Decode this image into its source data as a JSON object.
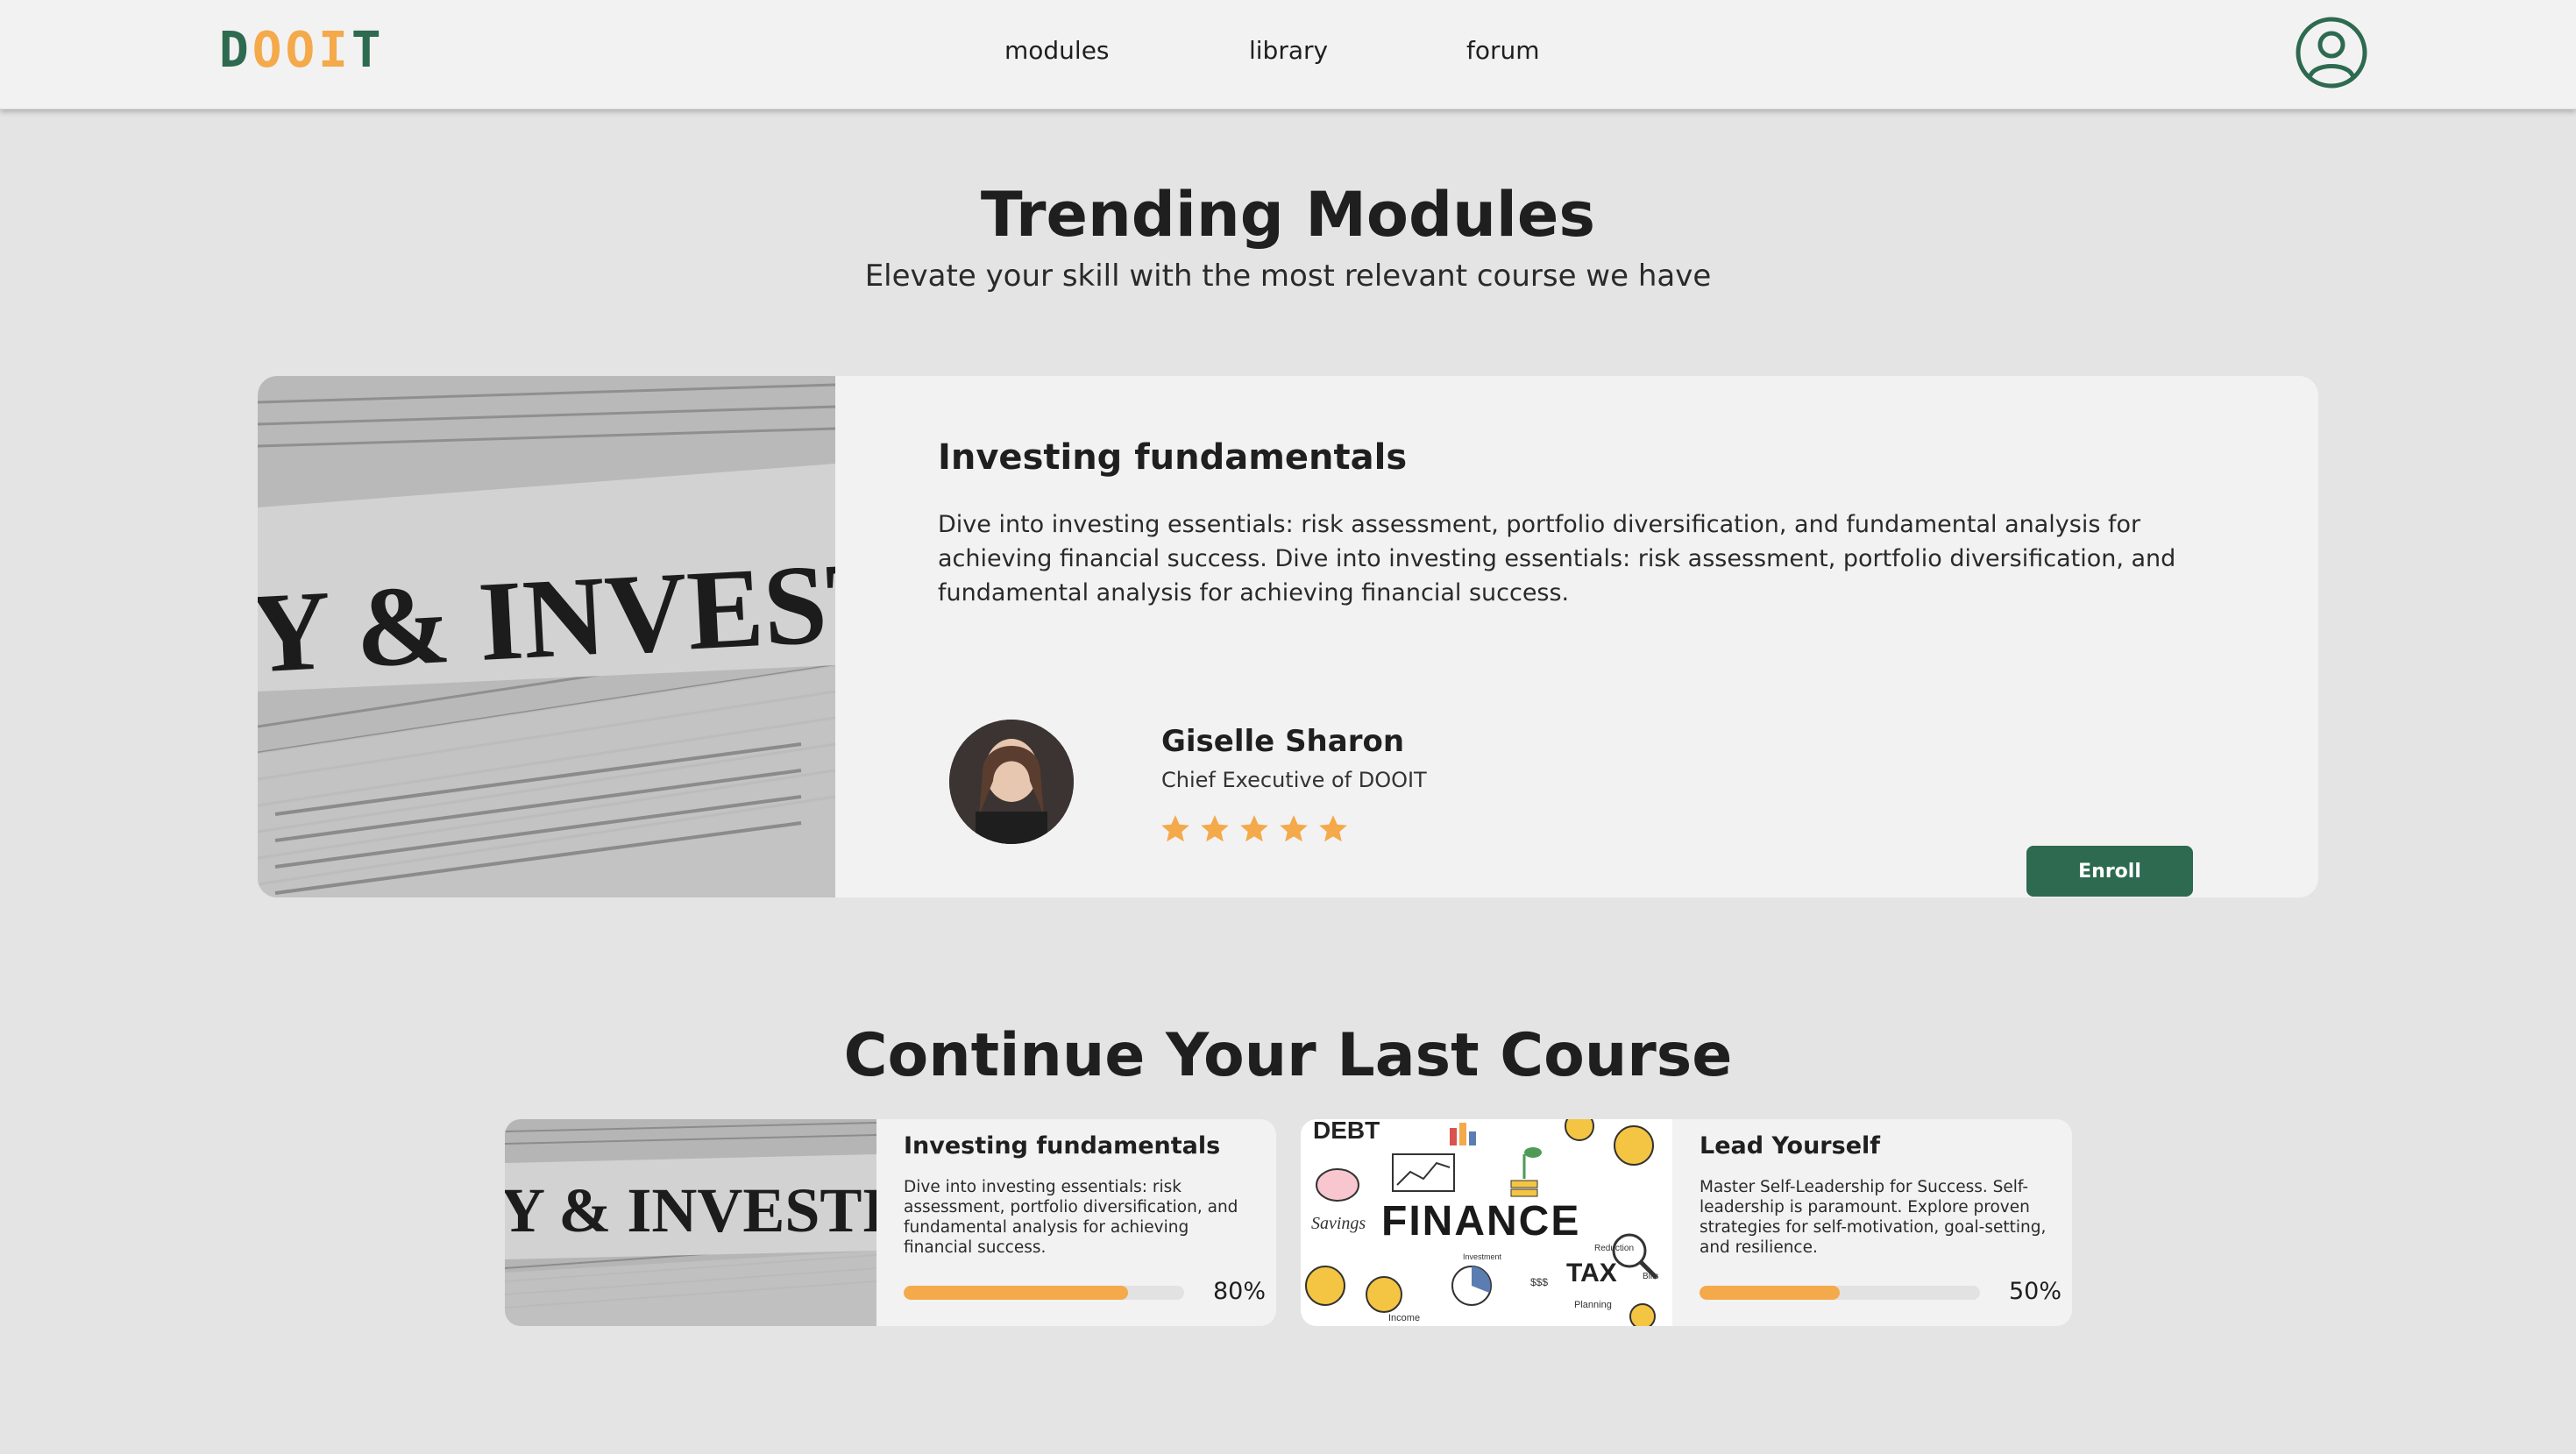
{
  "brand": {
    "logo_letters": [
      "D",
      "O",
      "O",
      "I",
      "T"
    ],
    "logo_colors": [
      "#2d6a4f",
      "#f4a94a",
      "#f4a94a",
      "#f4a94a",
      "#2d6a4f"
    ]
  },
  "nav": {
    "links": [
      "modules",
      "library",
      "forum"
    ],
    "profile_icon": "user-circle-icon"
  },
  "colors": {
    "accent_green": "#2d6a4f",
    "accent_orange": "#f4a94a",
    "background": "#e4e4e4",
    "card": "#f2f2f2"
  },
  "trending": {
    "title": "Trending Modules",
    "subtitle": "Elevate your skill with the most relevant course we have",
    "card": {
      "title": "Investing fundamentals",
      "description": "Dive into investing essentials: risk assessment, portfolio diversification, and fundamental analysis for achieving financial success. Dive into investing essentials: risk assessment, portfolio diversification, and fundamental analysis for achieving financial success.",
      "image_text": "INVESTING",
      "image_text_prefix": "Y &",
      "author": {
        "name": "Giselle Sharon",
        "role": "Chief Executive of DOOIT"
      },
      "rating": 5,
      "rating_max": 5,
      "enroll_label": "Enroll"
    }
  },
  "continue": {
    "title": "Continue Your Last Course",
    "courses": [
      {
        "title": "Investing fundamentals",
        "description": "Dive into investing essentials: risk assessment, portfolio diversification, and fundamental analysis for achieving financial success.",
        "progress": 80,
        "progress_label": "80%",
        "image_text": "INVESTING",
        "image_text_prefix": "Y &"
      },
      {
        "title": "Lead Yourself",
        "description": "Master Self-Leadership for Success. Self-leadership is paramount. Explore proven strategies for self-motivation, goal-setting, and resilience.",
        "progress": 50,
        "progress_label": "50%",
        "image_words": {
          "debt": "DEBT",
          "finance": "FINANCE",
          "savings": "Savings",
          "tax": "TAX",
          "investment": "Investment",
          "planning": "Planning",
          "income": "Income",
          "money": "$$$",
          "reduction": "Reduction",
          "bills": "Bills"
        }
      }
    ]
  }
}
